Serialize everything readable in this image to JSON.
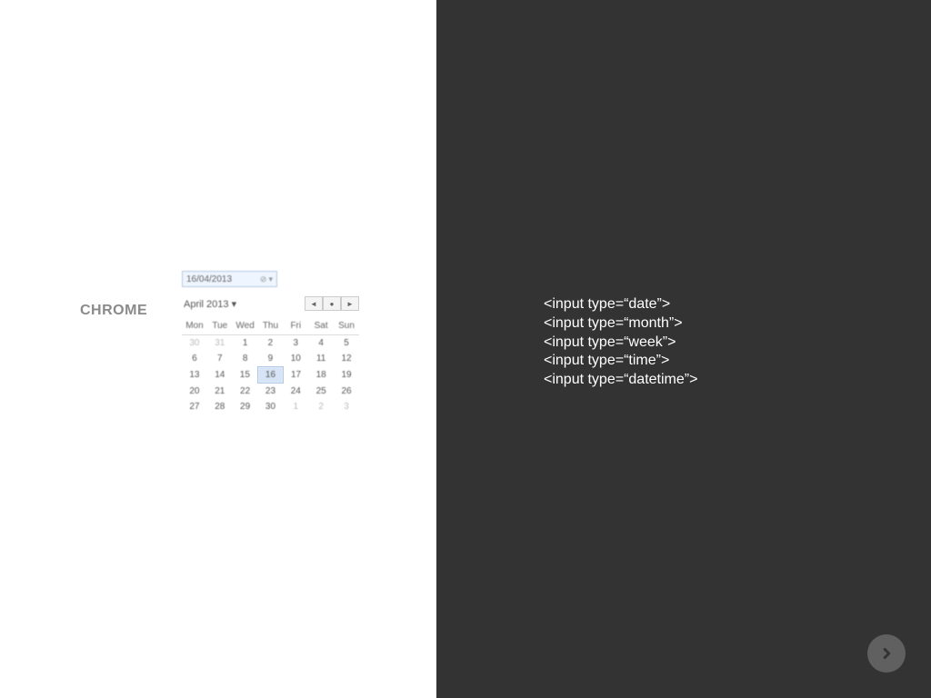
{
  "left": {
    "label": "CHROME",
    "date_value": "16/04/2013",
    "month_label": "April 2013 ▾",
    "weekdays": [
      "Mon",
      "Tue",
      "Wed",
      "Thu",
      "Fri",
      "Sat",
      "Sun"
    ],
    "rows": [
      [
        {
          "v": "30",
          "dim": true
        },
        {
          "v": "31",
          "dim": true
        },
        {
          "v": "1"
        },
        {
          "v": "2"
        },
        {
          "v": "3"
        },
        {
          "v": "4"
        },
        {
          "v": "5"
        }
      ],
      [
        {
          "v": "6"
        },
        {
          "v": "7"
        },
        {
          "v": "8"
        },
        {
          "v": "9"
        },
        {
          "v": "10"
        },
        {
          "v": "11"
        },
        {
          "v": "12"
        }
      ],
      [
        {
          "v": "13"
        },
        {
          "v": "14"
        },
        {
          "v": "15"
        },
        {
          "v": "16",
          "sel": true
        },
        {
          "v": "17"
        },
        {
          "v": "18"
        },
        {
          "v": "19"
        }
      ],
      [
        {
          "v": "20"
        },
        {
          "v": "21"
        },
        {
          "v": "22"
        },
        {
          "v": "23"
        },
        {
          "v": "24"
        },
        {
          "v": "25"
        },
        {
          "v": "26"
        }
      ],
      [
        {
          "v": "27"
        },
        {
          "v": "28"
        },
        {
          "v": "29"
        },
        {
          "v": "30"
        },
        {
          "v": "1",
          "dim": true
        },
        {
          "v": "2",
          "dim": true
        },
        {
          "v": "3",
          "dim": true
        }
      ]
    ],
    "nav": {
      "prev": "◄",
      "today": "●",
      "next": "►"
    }
  },
  "right": {
    "code_lines": [
      "<input type=“date”>",
      "<input type=“month”>",
      "<input type=“week”>",
      "<input type=“time”>",
      "<input type=“datetime”>"
    ]
  }
}
